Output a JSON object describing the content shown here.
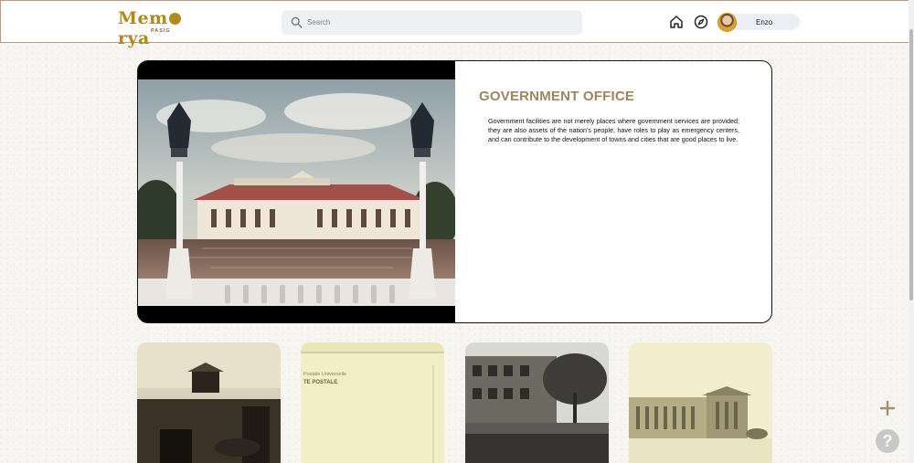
{
  "header": {
    "logo_text_1": "Mem",
    "logo_text_2": "rya",
    "logo_subtitle": "PASIG",
    "search_placeholder": "Search",
    "username": "Enzo"
  },
  "hero": {
    "title": "GOVERNMENT OFFICE",
    "description": "Government facilities are not merely places where government services are provided; they are also assets of the nation's people, have roles to play as emergency centers, and can contribute to the development of towns and cities that are good places to live."
  },
  "thumbnails": {
    "card_2_caption_1": "Postale Universelle",
    "card_2_caption_2": "TE POSTALE"
  },
  "floating": {
    "help_label": "?"
  },
  "colors": {
    "brand_gold": "#b08a1e",
    "title_tan": "#9c8661",
    "header_border": "#b89a86"
  }
}
